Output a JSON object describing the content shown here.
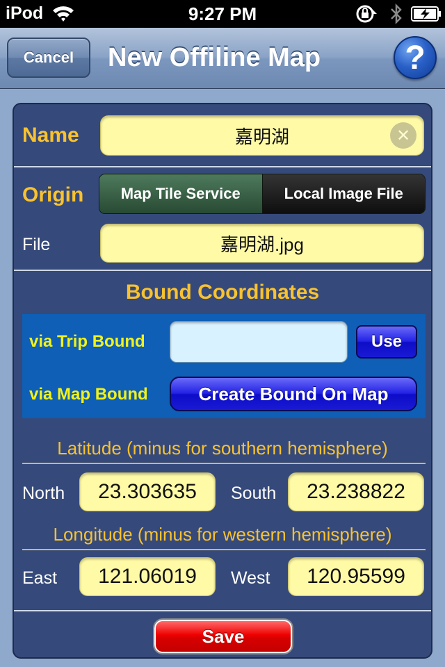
{
  "status_bar": {
    "carrier": "iPod",
    "time": "9:27 PM"
  },
  "nav": {
    "cancel_label": "Cancel",
    "title": "New Offiline Map",
    "help_label": "?"
  },
  "form": {
    "name_label": "Name",
    "name_value": "嘉明湖",
    "origin_label": "Origin",
    "origin_options": [
      "Map Tile Service",
      "Local Image File"
    ],
    "origin_selected": "Map Tile Service",
    "file_label": "File",
    "file_value": "嘉明湖.jpg",
    "bound": {
      "title": "Bound Coordinates",
      "trip_label": "via Trip Bound",
      "trip_value": "",
      "use_label": "Use",
      "map_label": "via Map Bound",
      "create_label": "Create Bound On Map"
    },
    "latitude": {
      "header": "Latitude (minus for southern hemisphere)",
      "north_label": "North",
      "north_value": "23.303635",
      "south_label": "South",
      "south_value": "23.238822"
    },
    "longitude": {
      "header": "Longitude (minus for western hemisphere)",
      "east_label": "East",
      "east_value": "121.06019",
      "west_label": "West",
      "west_value": "120.95599"
    },
    "save_label": "Save"
  },
  "colors": {
    "panel": "#35497a",
    "gold": "#f9c22e",
    "field": "#fffaa6",
    "bound_box": "#0e5fb5",
    "save": "#e00000"
  }
}
